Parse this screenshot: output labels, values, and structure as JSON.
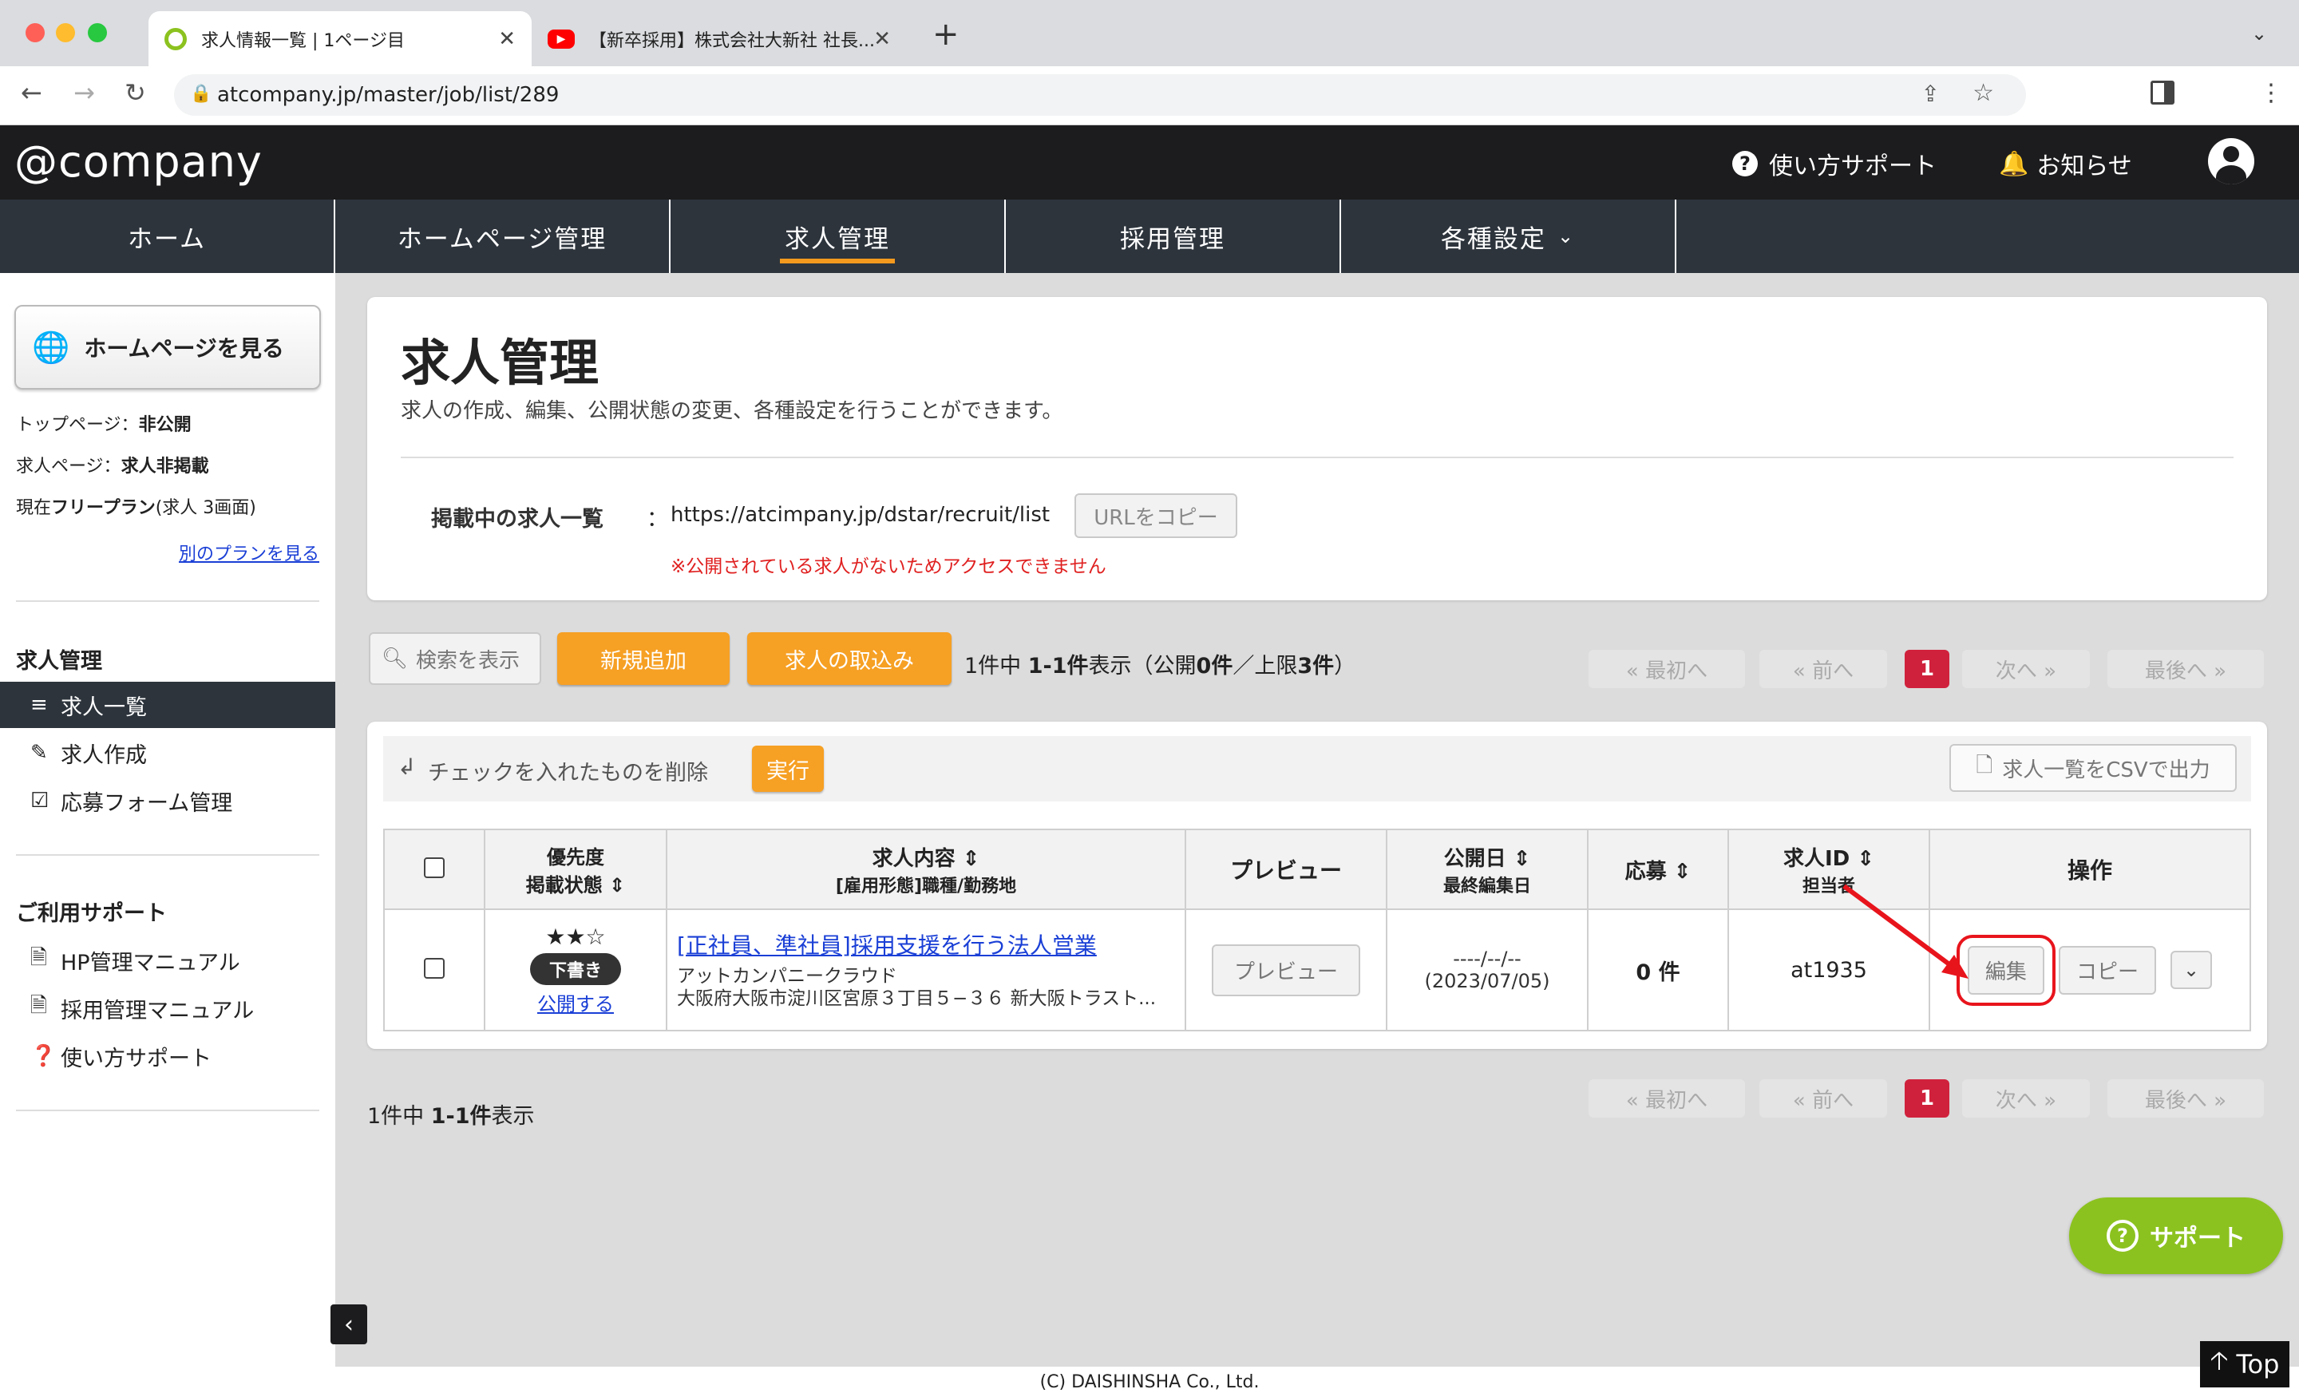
{
  "browser": {
    "tabs": [
      {
        "title": "求人情報一覧 | 1ページ目",
        "active": true
      },
      {
        "title": "【新卒採用】株式会社大新社 社長...",
        "active": false
      }
    ],
    "new_tab": "+",
    "url": "atcompany.jp/master/job/list/289"
  },
  "header": {
    "logo": "@company",
    "help": "使い方サポート",
    "notice": "お知らせ"
  },
  "nav": [
    {
      "label": "ホーム",
      "active": false
    },
    {
      "label": "ホームページ管理",
      "active": false
    },
    {
      "label": "求人管理",
      "active": true
    },
    {
      "label": "採用管理",
      "active": false
    },
    {
      "label": "各種設定",
      "active": false
    }
  ],
  "sidebar": {
    "view_hp": "ホームページを見る",
    "top_label": "トップページ：",
    "top_value": "非公開",
    "job_label": "求人ページ：",
    "job_value": "求人非掲載",
    "plan_pre": "現在",
    "plan_name": "フリープラン",
    "plan_post": "(求人 3画面)",
    "other_plan": "別のプランを見る",
    "sec1": "求人管理",
    "items1": [
      "求人一覧",
      "求人作成",
      "応募フォーム管理"
    ],
    "sec2": "ご利用サポート",
    "items2": [
      "HP管理マニュアル",
      "採用管理マニュアル",
      "使い方サポート"
    ]
  },
  "page": {
    "title": "求人管理",
    "desc": "求人の作成、編集、公開状態の変更、各種設定を行うことができます。",
    "list_label": "掲載中の求人一覧",
    "colon": "：",
    "list_url": "https://atcimpany.jp/dstar/recruit/list",
    "copy_url": "URLをコピー",
    "warning": "※公開されている求人がないためアクセスできません"
  },
  "toolbar": {
    "search": "検索を表示",
    "add": "新規追加",
    "import": "求人の取込み",
    "count_pre": "1件中 ",
    "count_range": "1-1件",
    "count_post": "表示（公開",
    "pub": "0件",
    "limit_pre": "／上限",
    "limit": "3件",
    "close": "）"
  },
  "pager": {
    "first": "« 最初へ",
    "prev": "« 前へ",
    "current": "1",
    "next": "次へ »",
    "last": "最後へ »"
  },
  "bulk": {
    "label": "チェックを入れたものを削除",
    "exec": "実行",
    "csv": "求人一覧をCSVで出力"
  },
  "table": {
    "h_priority": "優先度",
    "h_status": "掲載状態",
    "h_content": "求人内容",
    "h_content_sub": "[雇用形態]職種/勤務地",
    "h_preview": "プレビュー",
    "h_date": "公開日",
    "h_date_sub": "最終編集日",
    "h_apply": "応募",
    "h_id": "求人ID",
    "h_id_sub": "担当者",
    "h_ops": "操作",
    "row": {
      "stars": "★★☆",
      "status": "下書き",
      "publish": "公開する",
      "title": "[正社員、準社員]採用支援を行う法人営業",
      "company": "アットカンパニークラウド",
      "address": "大阪府大阪市淀川区宮原３丁目５−３６ 新大阪トラスト...",
      "preview": "プレビュー",
      "date": "----/--/--",
      "edited": "(2023/07/05)",
      "apply": "0 件",
      "id": "at1935",
      "edit": "編集",
      "copy": "コピー"
    }
  },
  "bottom_count_pre": "1件中 ",
  "bottom_count_range": "1-1件",
  "bottom_count_post": "表示",
  "support_btn": "サポート",
  "top_btn": "Top",
  "footer": "(C) DAISHINSHA Co., Ltd.",
  "colors": {
    "accent": "#f6a024",
    "nav_bg": "#2d343c",
    "header_bg": "#1c1c1e",
    "support": "#8cc21f",
    "danger": "#d0213c"
  }
}
